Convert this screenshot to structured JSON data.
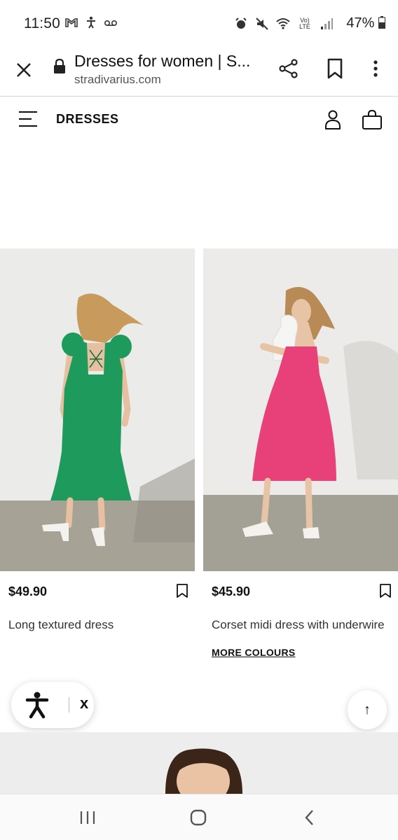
{
  "status_bar": {
    "time": "11:50",
    "battery": "47%",
    "left_icons": [
      "gmail-icon",
      "accessibility-person-icon",
      "voicemail-icon"
    ],
    "right_icons": [
      "alarm-icon",
      "mute-icon",
      "wifi-icon",
      "volte-icon",
      "signal-icon",
      "battery-icon"
    ],
    "volte_label": "Vo) LTE"
  },
  "browser": {
    "title": "Dresses for women | S...",
    "url": "stradivarius.com"
  },
  "header": {
    "section_title": "DRESSES"
  },
  "products": [
    {
      "price": "$49.90",
      "name": "Long textured dress",
      "dress_color": "#1e9a5c"
    },
    {
      "price": "$45.90",
      "name": "Corset midi dress with underwire",
      "more_colours": "MORE COLOURS",
      "dress_color": "#e8417a"
    }
  ],
  "floating": {
    "a11y_close": "x",
    "top_arrow": "↑"
  }
}
